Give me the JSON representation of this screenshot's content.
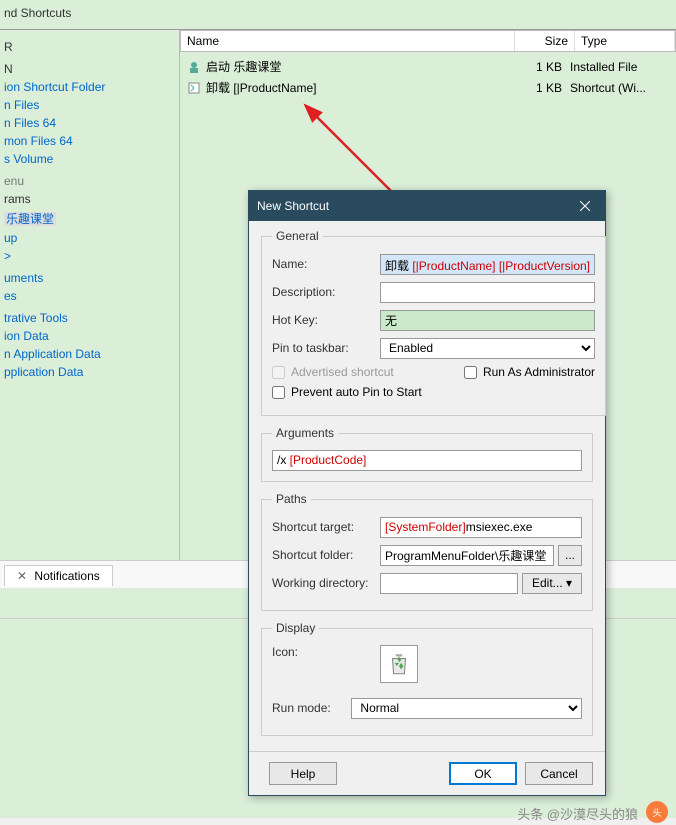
{
  "toolbar": {
    "title": "nd Shortcuts"
  },
  "sidebar": {
    "items": [
      {
        "label": "R",
        "type": "hdr"
      },
      {
        "label": "",
        "type": "sp"
      },
      {
        "label": "N",
        "type": "hdr"
      },
      {
        "label": "ion Shortcut Folder"
      },
      {
        "label": "n Files"
      },
      {
        "label": "n Files 64"
      },
      {
        "label": "mon Files 64"
      },
      {
        "label": "s Volume"
      },
      {
        "label": "",
        "type": "sp"
      },
      {
        "label": "enu",
        "type": "dim"
      },
      {
        "label": "rams",
        "type": "hdr"
      },
      {
        "label": "乐趣课堂",
        "type": "hl"
      },
      {
        "label": "up"
      },
      {
        "label": ">"
      },
      {
        "label": "",
        "type": "sp"
      },
      {
        "label": "uments"
      },
      {
        "label": "es"
      },
      {
        "label": "",
        "type": "sp"
      },
      {
        "label": "trative Tools"
      },
      {
        "label": "ion Data"
      },
      {
        "label": "n Application Data"
      },
      {
        "label": "pplication Data"
      }
    ]
  },
  "list": {
    "headers": {
      "name": "Name",
      "size": "Size",
      "type": "Type"
    },
    "rows": [
      {
        "name": "启动 乐趣课堂",
        "size": "1 KB",
        "type": "Installed File"
      },
      {
        "name": "卸载 [|ProductName]",
        "size": "1 KB",
        "type": "Shortcut (Wi..."
      }
    ]
  },
  "tabs": {
    "notifications": "Notifications"
  },
  "dialog": {
    "title": "New Shortcut",
    "general": {
      "legend": "General",
      "name_label": "Name:",
      "name_prefix": "卸载 ",
      "name_p1": "[|ProductName]",
      "name_sep": " ",
      "name_p2": "[|ProductVersion]",
      "desc_label": "Description:",
      "hotkey_label": "Hot Key:",
      "hotkey_value": "无",
      "pin_label": "Pin to taskbar:",
      "pin_value": "Enabled",
      "adv_label": "Advertised shortcut",
      "runas_label": "Run As Administrator",
      "prevent_label": "Prevent auto Pin to Start"
    },
    "arguments": {
      "legend": "Arguments",
      "prefix": "/x ",
      "value": "[ProductCode]"
    },
    "paths": {
      "legend": "Paths",
      "target_label": "Shortcut target:",
      "target_red": "[SystemFolder]",
      "target_suffix": "msiexec.exe",
      "folder_label": "Shortcut folder:",
      "folder_value": "ProgramMenuFolder\\乐趣课堂",
      "wd_label": "Working directory:",
      "edit_btn": "Edit... ▾"
    },
    "display": {
      "legend": "Display",
      "icon_label": "Icon:",
      "run_label": "Run mode:",
      "run_value": "Normal"
    },
    "footer": {
      "help": "Help",
      "ok": "OK",
      "cancel": "Cancel"
    }
  },
  "watermark": "头条 @沙漠尽头的狼"
}
